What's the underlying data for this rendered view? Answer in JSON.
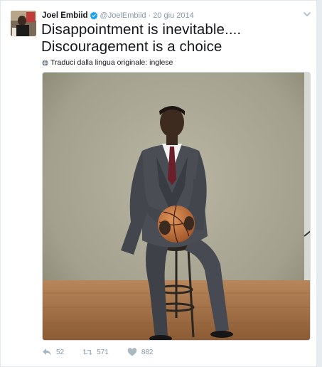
{
  "tweet": {
    "display_name": "Joel Embiid",
    "handle": "@JoelEmbiid",
    "separator": "·",
    "date": "20 giu 2014",
    "text_line1": "Disappointment is inevitable....",
    "text_line2": "Discouragement is a choice",
    "translate_label": "Traduci dalla lingua originale: inglese"
  },
  "actions": {
    "replies": "52",
    "retweets": "571",
    "likes": "882"
  },
  "colors": {
    "verified": "#1da1f2",
    "meta_text": "#8899a6",
    "tweet_text": "#14171a"
  },
  "icons": [
    "verified-badge-icon",
    "chevron-down-icon",
    "globe-icon",
    "reply-icon",
    "retweet-icon",
    "like-icon"
  ]
}
